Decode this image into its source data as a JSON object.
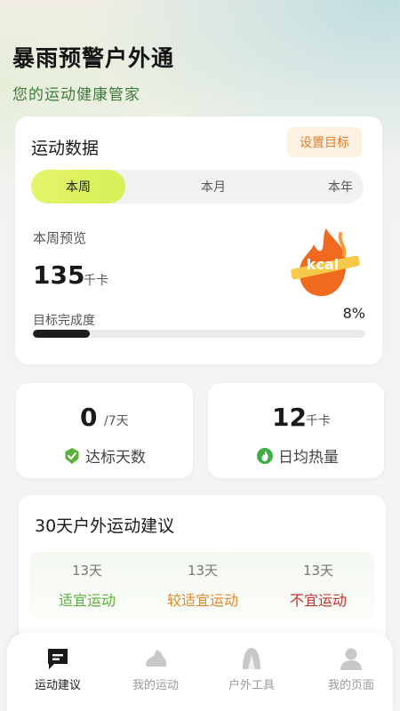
{
  "header": {
    "title": "暴雨预警户外通",
    "subtitle": "您的运动健康管家"
  },
  "sport_data": {
    "title": "运动数据",
    "set_goal_label": "设置目标",
    "tabs": [
      {
        "label": "本周",
        "active": true
      },
      {
        "label": "本月",
        "active": false
      },
      {
        "label": "本年",
        "active": false
      }
    ],
    "overview_label": "本周预览",
    "calories": "135",
    "calories_unit": "千卡",
    "badge_text": "kcal",
    "goal_label": "目标完成度",
    "goal_percent_text": "8%",
    "goal_fraction": 0.17
  },
  "stats": {
    "days": {
      "value": "0",
      "unit": "/7天",
      "label": "达标天数",
      "icon": "shield-check-icon"
    },
    "daily": {
      "value": "12",
      "unit": "千卡",
      "label": "日均热量",
      "icon": "flame-icon"
    }
  },
  "advice": {
    "title": "30天户外运动建议",
    "items": [
      {
        "days": "13天",
        "label": "适宜运动",
        "color": "#58b13b"
      },
      {
        "days": "13天",
        "label": "较适宜运动",
        "color": "#e08a2a"
      },
      {
        "days": "13天",
        "label": "不宜运动",
        "color": "#c8312d"
      }
    ]
  },
  "nav": [
    {
      "label": "运动建议",
      "icon": "chat-icon",
      "active": true
    },
    {
      "label": "我的运动",
      "icon": "shoe-icon",
      "active": false
    },
    {
      "label": "户外工具",
      "icon": "tent-icon",
      "active": false
    },
    {
      "label": "我的页面",
      "icon": "user-icon",
      "active": false
    }
  ],
  "colors": {
    "accent_green": "#d8ef57",
    "brand_green": "#3e7a3a",
    "goal_button": "#fdf1e4"
  }
}
